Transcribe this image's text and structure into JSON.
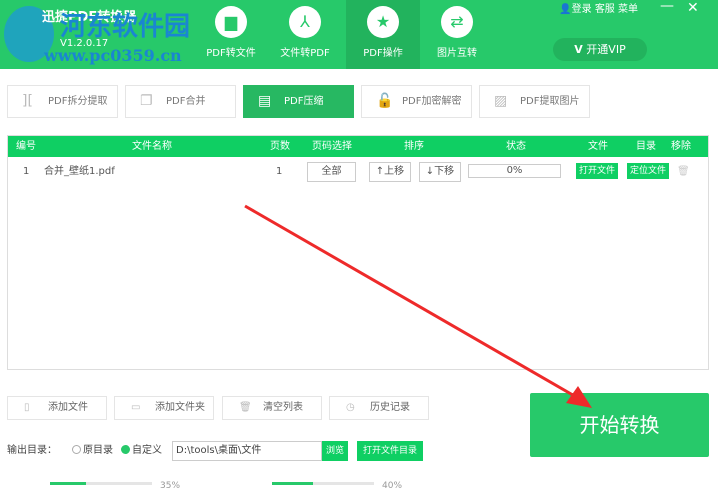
{
  "app": {
    "name": "迅捷PDF转换器",
    "version": "V1.2.0.17",
    "watermark": "河东软件园",
    "watermark_url": "www.pc0359.cn"
  },
  "nav": [
    {
      "label": "PDF转文件",
      "icon": "folder-icon"
    },
    {
      "label": "文件转PDF",
      "icon": "pdf-icon"
    },
    {
      "label": "PDF操作",
      "icon": "star-icon"
    },
    {
      "label": "图片互转",
      "icon": "swap-icon"
    }
  ],
  "top_right": {
    "login": "登录",
    "service": "客服",
    "menu": "菜单",
    "vip": "开通VIP"
  },
  "tools": [
    {
      "label": "PDF拆分提取"
    },
    {
      "label": "PDF合并"
    },
    {
      "label": "PDF压缩"
    },
    {
      "label": "PDF加密解密"
    },
    {
      "label": "PDF提取图片"
    }
  ],
  "table": {
    "headers": [
      "编号",
      "文件名称",
      "页数",
      "页码选择",
      "排序",
      "状态",
      "文件",
      "目录",
      "移除"
    ],
    "rows": [
      {
        "num": "1",
        "name": "合并_壁纸1.pdf",
        "pages": "1",
        "range": "全部",
        "up": "↑上移",
        "down": "↓下移",
        "status": "0%",
        "progress": 0,
        "open": "打开文件",
        "locate": "定位文件"
      }
    ]
  },
  "actions": {
    "add_file": "添加文件",
    "add_folder": "添加文件夹",
    "clear": "清空列表",
    "history": "历史记录",
    "start": "开始转换"
  },
  "output": {
    "label": "输出目录：",
    "opt_original": "原目录",
    "opt_custom": "自定义",
    "path": "D:\\tools\\桌面\\文件",
    "browse": "浏览",
    "open_dir": "打开文件目录"
  },
  "sliders": {
    "clarity_value": "35%",
    "clarity": 35,
    "ratio_value": "40%",
    "ratio": 40
  }
}
